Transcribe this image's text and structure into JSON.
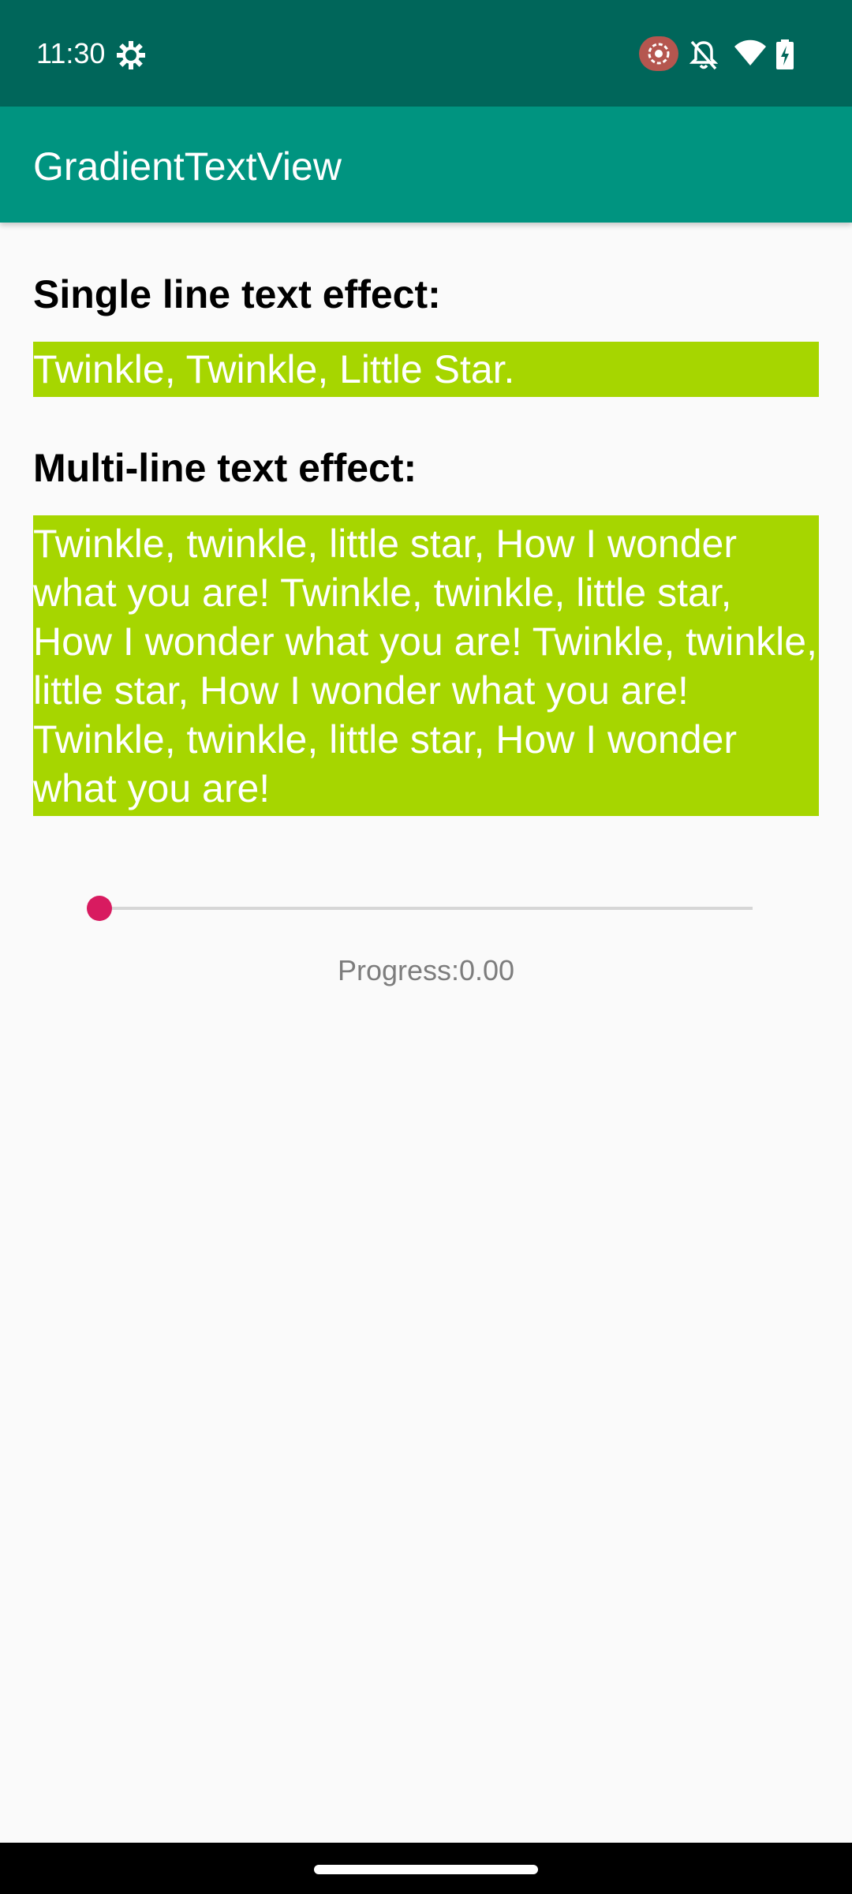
{
  "status_bar": {
    "time": "11:30",
    "icons": [
      "settings-gear-icon",
      "screen-record-icon",
      "notifications-off-icon",
      "wifi-icon",
      "battery-charging-icon"
    ]
  },
  "app_bar": {
    "title": "GradientTextView"
  },
  "main": {
    "single_heading": "Single line text effect:",
    "single_text": "Twinkle, Twinkle, Little Star.",
    "multi_heading": "Multi-line text effect:",
    "multi_text": "Twinkle, twinkle, little star, How I wonder what you are! Twinkle, twinkle, little star, How I wonder what you are! Twinkle, twinkle, little star, How I wonder what you are! Twinkle, twinkle, little star, How I wonder what you are!",
    "slider_value": 0.0,
    "progress_text": "Progress:0.00"
  },
  "colors": {
    "status_bar": "#00665a",
    "app_bar": "#009480",
    "text_box": "#a6d600",
    "slider_thumb": "#d81b60",
    "record_badge": "#b5564f"
  }
}
